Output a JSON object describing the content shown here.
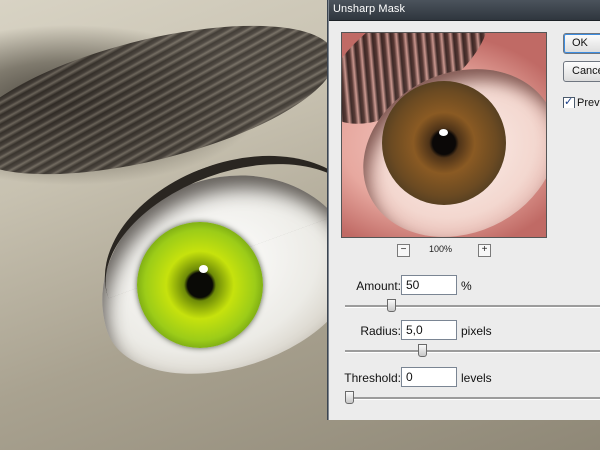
{
  "dialog": {
    "title": "Unsharp Mask",
    "ok_label": "OK",
    "cancel_label": "Cancel",
    "preview_checkbox": {
      "label": "Preview",
      "checked": true
    },
    "zoom": {
      "minus": "−",
      "plus": "+",
      "level": "100%"
    }
  },
  "controls": {
    "amount": {
      "label": "Amount:",
      "value": "50",
      "unit": "%",
      "slider_fraction": 0.16
    },
    "radius": {
      "label": "Radius:",
      "value": "5,0",
      "unit": "pixels",
      "slider_fraction": 0.28
    },
    "threshold": {
      "label": "Threshold:",
      "value": "0",
      "unit": "levels",
      "slider_fraction": 0.0
    }
  },
  "colors": {
    "titlebar": "#3a4149",
    "dialog_bg": "#ececec",
    "checkmark": "#1b3f8a"
  }
}
